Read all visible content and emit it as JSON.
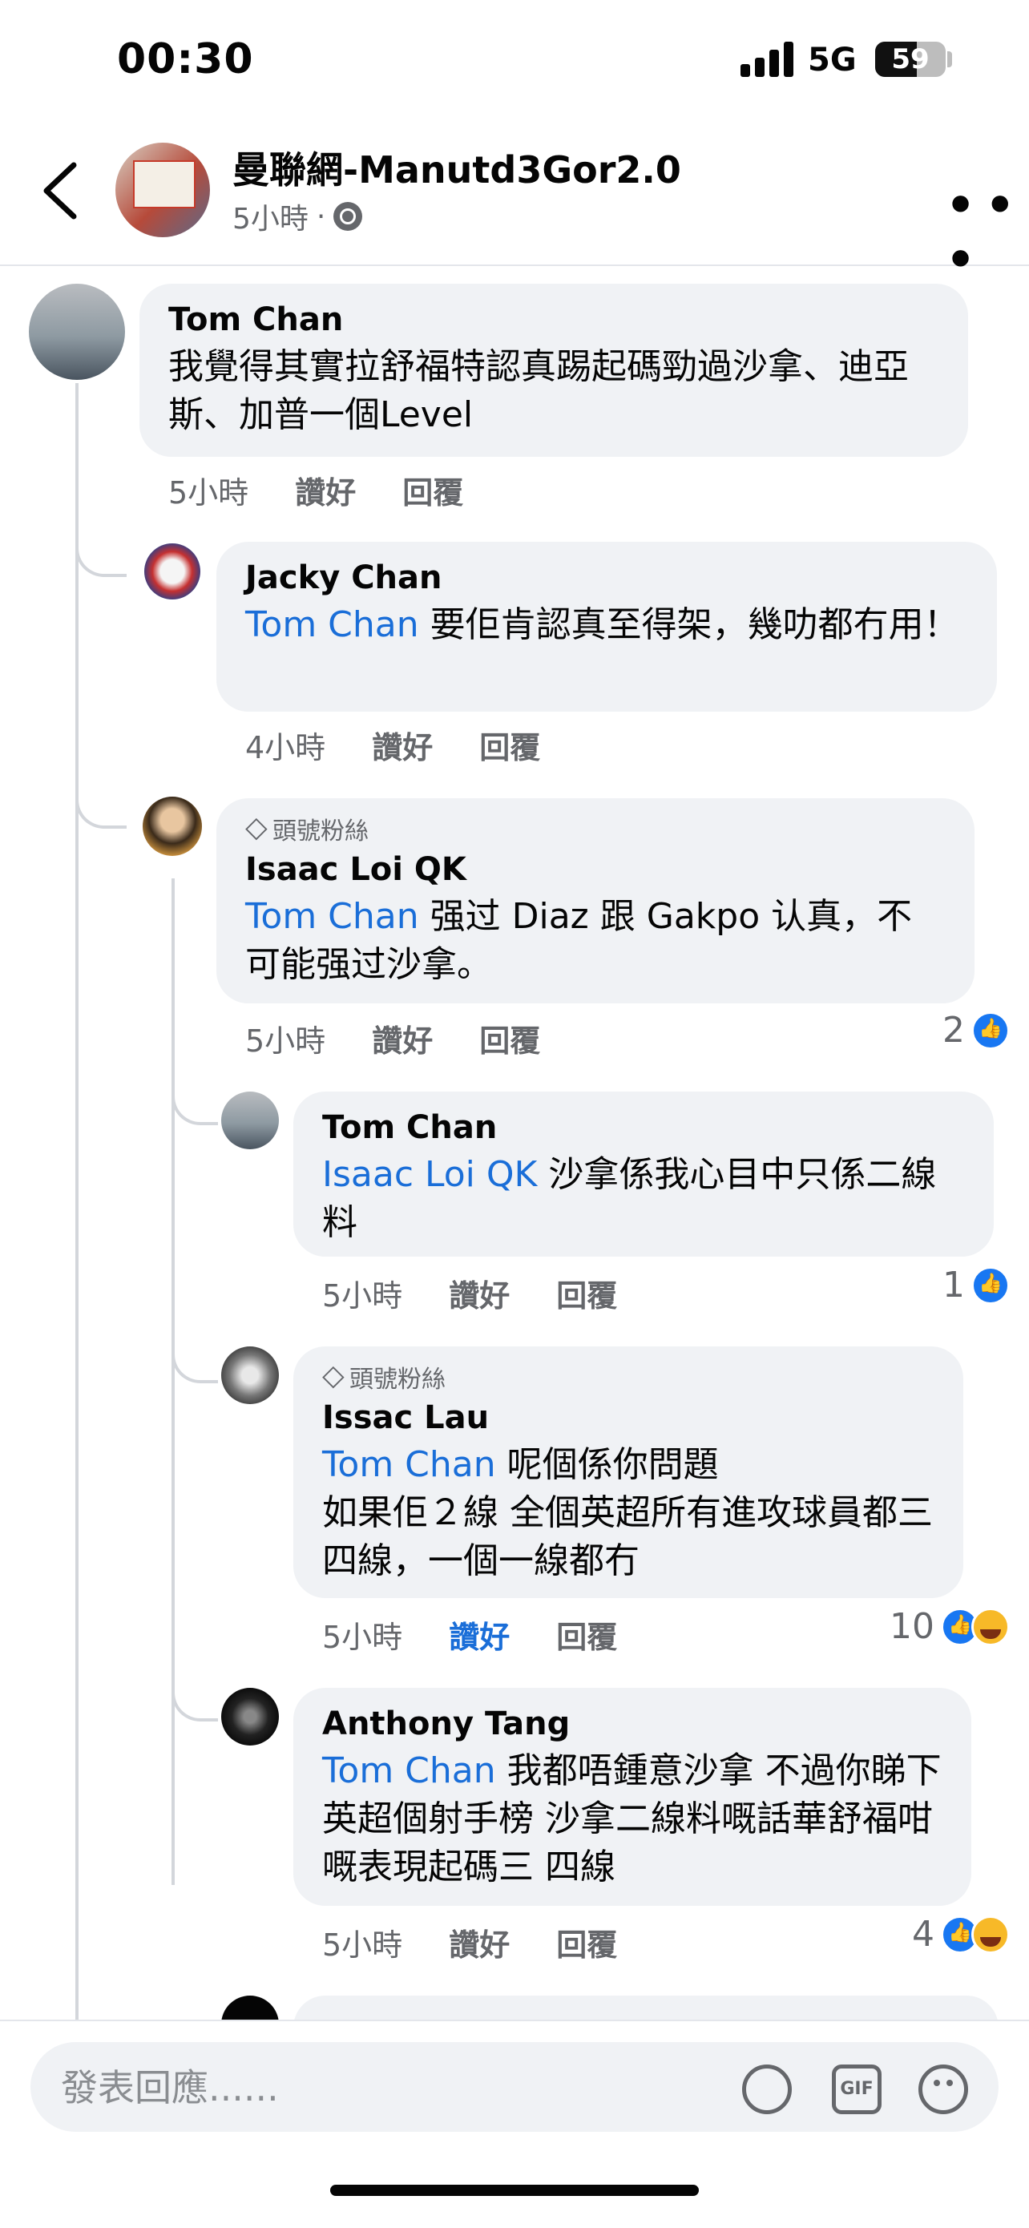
{
  "status_bar": {
    "time": "00:30",
    "network": "5G",
    "battery": "59",
    "battery_level": 0.59
  },
  "header": {
    "page_name": "曼聯網-Manutd3Gor2.0",
    "time": "5小時",
    "separator": "·"
  },
  "labels": {
    "like": "讚好",
    "reply": "回覆",
    "top_fan": "頭號粉絲"
  },
  "comments": [
    {
      "author": "Tom Chan",
      "mention": "",
      "text": "我覺得其實拉舒福特認真踢起碼勁過沙拿、迪亞斯、加普一個Level",
      "time": "5小時",
      "reaction_count": ""
    },
    {
      "author": "Jacky Chan",
      "mention": "Tom Chan",
      "text": " 要佢肯認真至得架，幾叻都冇用！",
      "time": "4小時",
      "reaction_count": ""
    },
    {
      "author": "Isaac Loi QK",
      "mention": "Tom Chan",
      "text": " 强过 Diaz 跟 Gakpo 认真，不可能强过沙拿。",
      "time": "5小時",
      "reaction_count": "2"
    },
    {
      "author": "Tom Chan",
      "mention": "Isaac Loi QK",
      "text": " 沙拿係我心目中只係二線料",
      "time": "5小時",
      "reaction_count": "1"
    },
    {
      "author": "Issac Lau",
      "mention": "Tom Chan",
      "text": " 呢個係你問題\n如果佢２線 全個英超所有進攻球員都三四線，一個一線都冇",
      "time": "5小時",
      "reaction_count": "10"
    },
    {
      "author": "Anthony Tang",
      "mention": "Tom Chan",
      "text": " 我都唔鍾意沙拿 不過你睇下英超個射手榜 沙拿二線料嘅話華舒福咁嘅表現起碼三 四線",
      "time": "5小時",
      "reaction_count": "4"
    }
  ],
  "composer": {
    "placeholder": "發表回應......",
    "gif_label": "GIF"
  }
}
